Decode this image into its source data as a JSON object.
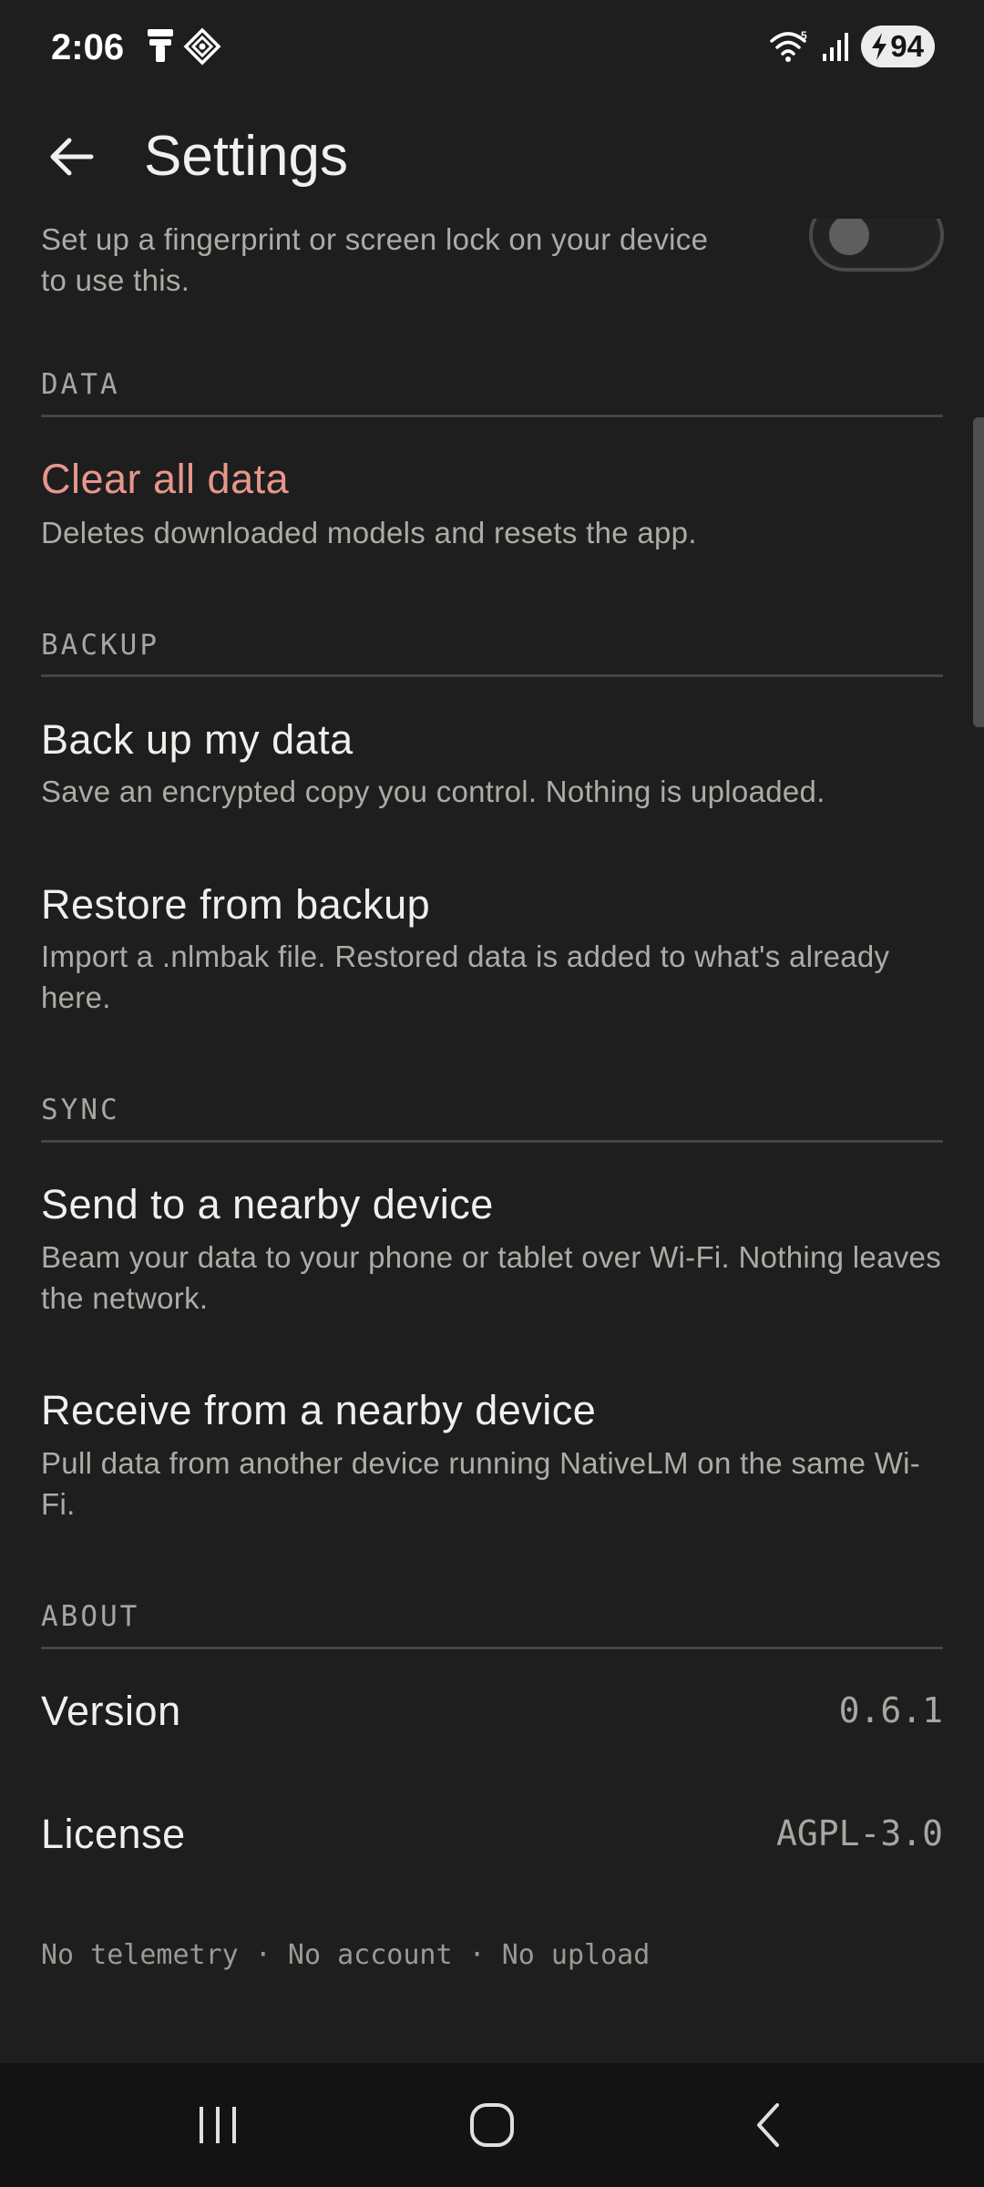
{
  "status_bar": {
    "time": "2:06",
    "battery": "94",
    "wifi_badge": "5",
    "icons": [
      "notification-app-icon",
      "notification-diamond-icon",
      "wifi-icon",
      "signal-icon",
      "battery-charging-icon"
    ]
  },
  "app_bar": {
    "title": "Settings",
    "back_icon": "arrow-left-icon"
  },
  "security": {
    "description": "Set up a fingerprint or screen lock on your device to use this.",
    "toggle_on": false
  },
  "sections": {
    "data": {
      "header": "DATA",
      "clear_all": {
        "title": "Clear all data",
        "description": "Deletes downloaded models and resets the app."
      }
    },
    "backup": {
      "header": "BACKUP",
      "back_up": {
        "title": "Back up my data",
        "description": "Save an encrypted copy you control. Nothing is uploaded."
      },
      "restore": {
        "title": "Restore from backup",
        "description": "Import a .nlmbak file. Restored data is added to what's already here."
      }
    },
    "sync": {
      "header": "SYNC",
      "send": {
        "title": "Send to a nearby device",
        "description": "Beam your data to your phone or tablet over Wi-Fi. Nothing leaves the network."
      },
      "receive": {
        "title": "Receive from a nearby device",
        "description": "Pull data from another device running NativeLM on the same Wi-Fi."
      }
    },
    "about": {
      "header": "ABOUT",
      "version": {
        "label": "Version",
        "value": "0.6.1"
      },
      "license": {
        "label": "License",
        "value": "AGPL-3.0"
      }
    }
  },
  "footer": {
    "text": "No telemetry · No account · No upload"
  },
  "nav_bar": {
    "icons": [
      "recent-apps-icon",
      "home-icon",
      "back-icon"
    ]
  },
  "colors": {
    "background": "#1e1e1e",
    "danger": "#e8968c",
    "text_primary": "#f1efec",
    "text_secondary": "#aeaba6"
  }
}
